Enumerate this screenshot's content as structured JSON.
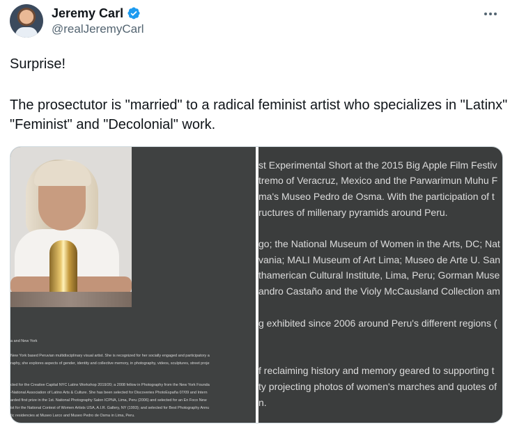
{
  "tweet": {
    "author": {
      "display_name": "Jeremy Carl",
      "handle": "@realJeremyCarl",
      "verified_icon": "verified-badge-icon",
      "accent_color": "#1d9bf0"
    },
    "more_menu_icon": "more-horizontal-icon",
    "text_line_1": "Surprise!",
    "text_line_2": "The prosectutor is \"married\" to a radical feminist artist who specializes in \"Latinx\" \"Feminist\" and \"Decolonial\" work."
  },
  "media": {
    "left_panel": {
      "lines": [
        "a and New York",
        "New York based Peruvian multidisciplinary visual artist. She is recognized for her socially engaged and participatory a",
        "raphy, she explores aspects of gender, identity and collective memory, in photography, videos, sculptures, street proje",
        "cted for the Creative Capital NYC Latinx Workshop 2019/20; a 2008 fellow in Photography from the New York Founda",
        "-National Association of Latino Arts & Culture. She has been selected for Discoveries PhotoEspaña 07/09 and Intern",
        "arded first prize in the 1st. National Photography Salon ICPNA, Lima, Peru (2006) and selected for an En Foco New",
        "ist for the National Contest of Women Artists USA, A.I.R. Gallery, NY (1993); and selected for Best Photography Annu",
        "tic residencies at Museo Larco and Museo Pedro de Osma in Lima, Peru."
      ]
    },
    "right_panel": {
      "lines": [
        "st Experimental Short at the 2015 Big Apple Film Festiv",
        "tremo of Veracruz, Mexico and the Parwarimun Muhu F",
        "ma's Museo Pedro de Osma. With the participation of t",
        "ructures of millenary pyramids around Peru.",
        "go; the National Museum of Women in the Arts, DC; Nat",
        "vania; MALI Museum of Art Lima; Museo de Arte U. San",
        "thamerican Cultural Institute, Lima, Peru; Gorman Muse",
        "andro Castaño and the Violy McCausland Collection am",
        "g exhibited since 2006 around Peru's different regions (",
        "f reclaiming history and memory geared to supporting t",
        "ty projecting photos of women's marches and quotes of",
        "n."
      ]
    }
  }
}
